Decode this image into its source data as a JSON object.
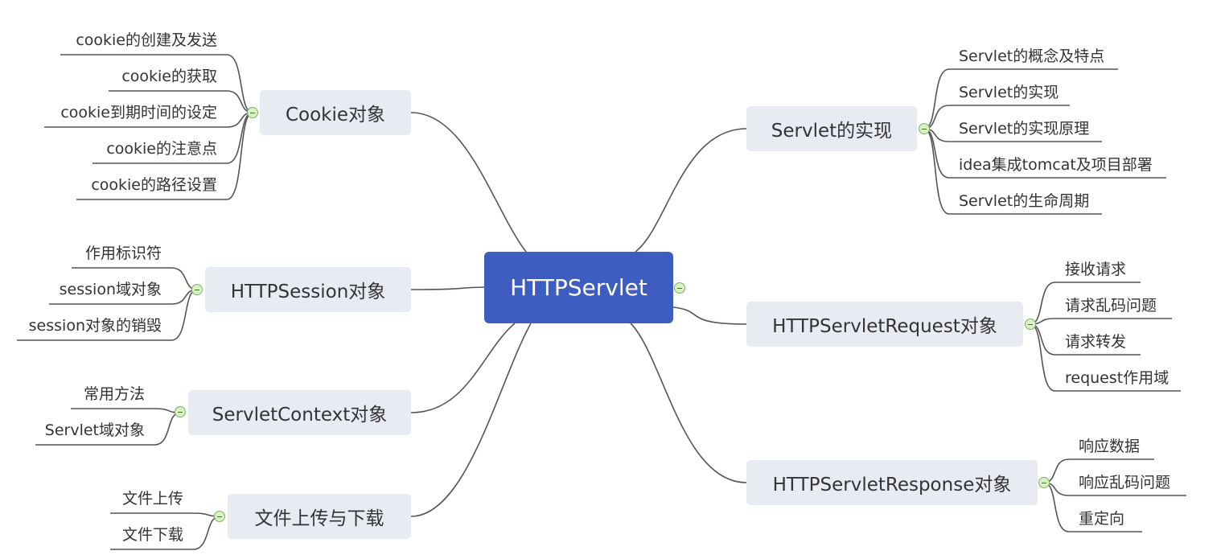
{
  "root": {
    "label": "HTTPServlet"
  },
  "right_branches": [
    {
      "label": "Servlet的实现",
      "children": [
        "Servlet的概念及特点",
        "Servlet的实现",
        "Servlet的实现原理",
        "idea集成tomcat及项目部署",
        "Servlet的生命周期"
      ]
    },
    {
      "label": "HTTPServletRequest对象",
      "children": [
        "接收请求",
        "请求乱码问题",
        "请求转发",
        "request作用域"
      ]
    },
    {
      "label": "HTTPServletResponse对象",
      "children": [
        "响应数据",
        "响应乱码问题",
        "重定向"
      ]
    }
  ],
  "left_branches": [
    {
      "label": "Cookie对象",
      "children": [
        "cookie的创建及发送",
        "cookie的获取",
        "cookie到期时间的设定",
        "cookie的注意点",
        "cookie的路径设置"
      ]
    },
    {
      "label": "HTTPSession对象",
      "children": [
        "作用标识符",
        "session域对象",
        "session对象的销毁"
      ]
    },
    {
      "label": "ServletContext对象",
      "children": [
        "常用方法",
        "Servlet域对象"
      ]
    },
    {
      "label": "文件上传与下载",
      "children": [
        "文件上传",
        "文件下载"
      ]
    }
  ],
  "colors": {
    "root": "#3f5cc0",
    "topic": "#e9ebf3",
    "line": "#555555",
    "toggle": "#d9f0c9"
  },
  "icons": {
    "collapse_toggle": "minus-circle-icon"
  }
}
